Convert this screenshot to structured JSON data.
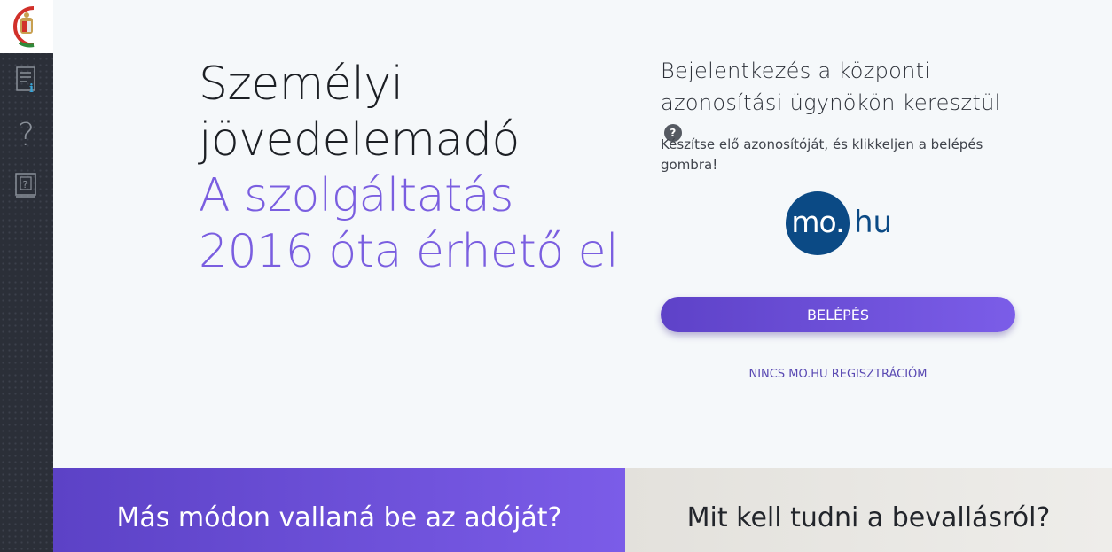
{
  "sidebar": {
    "logo": "hungarian-coat-of-arms-logo",
    "items": [
      {
        "icon": "document-info-icon"
      },
      {
        "icon": "question-mark-icon"
      },
      {
        "icon": "help-book-icon"
      }
    ]
  },
  "hero": {
    "title": "Személyi jövedelemadó",
    "subtitle": "A szolgáltatás 2016 óta érhető el"
  },
  "login": {
    "heading": "Bejelentkezés a központi azonosítási ügynökön keresztül",
    "help_badge": "?",
    "description": "Készítse elő azonosítóját, és klikkeljen a belépés gombra!",
    "provider_logo_main": "mo.",
    "provider_logo_suffix": "hu",
    "button_label": "BELÉPÉS",
    "no_registration_link": "NINCS MO.HU REGISZTRÁCIÓM"
  },
  "bottom": {
    "left_label": "Más módon vallaná be az adóját?",
    "right_label": "Mit kell tudni a bevallásról?"
  },
  "colors": {
    "accent": "#7a5ee0",
    "sidebar": "#2b2f38",
    "mohu_blue": "#0b4a85",
    "icon_blue": "#3aa6d8"
  }
}
